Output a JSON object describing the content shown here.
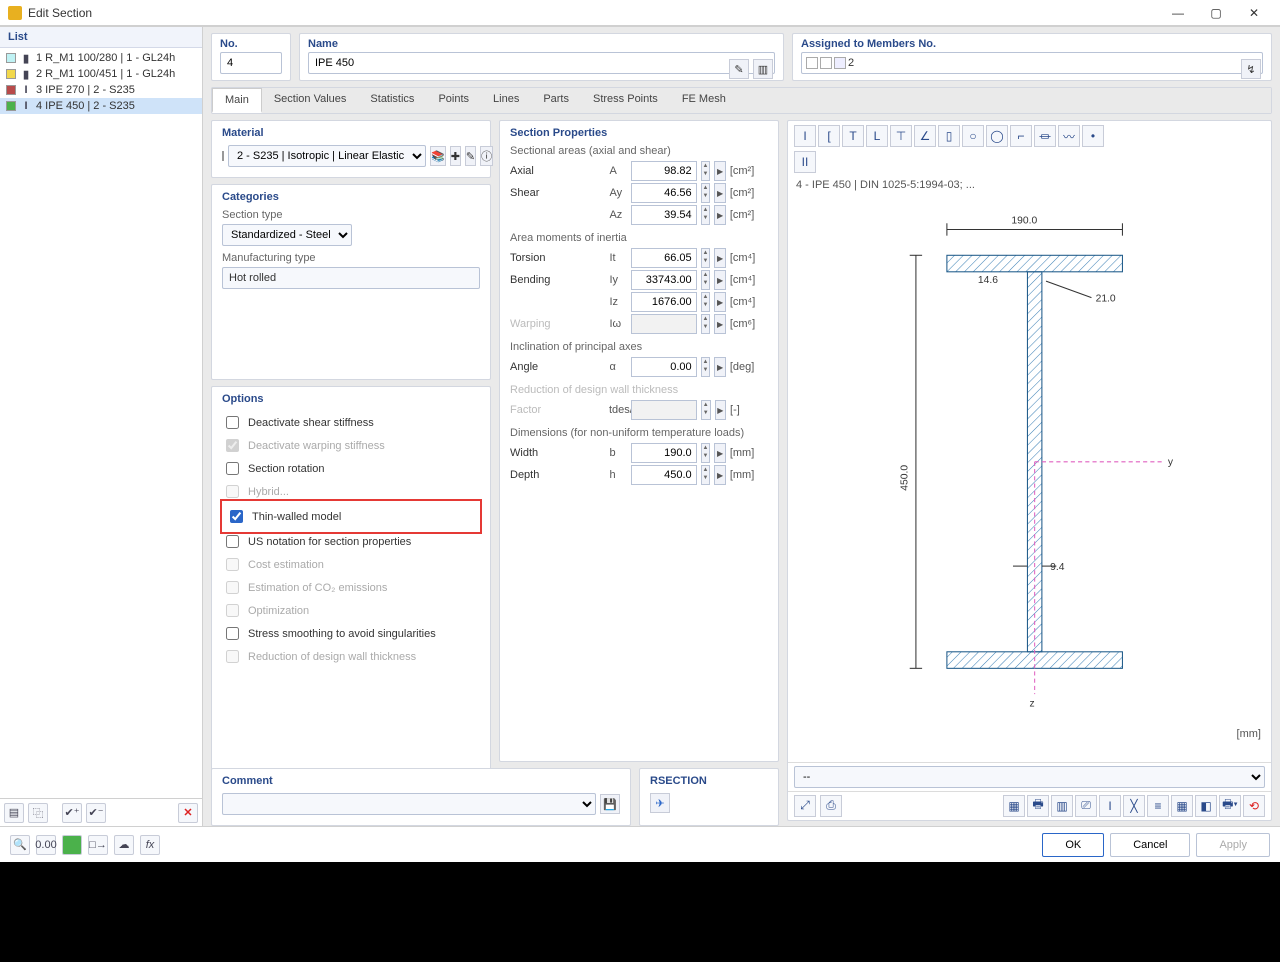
{
  "window": {
    "title": "Edit Section"
  },
  "left": {
    "header": "List",
    "items": [
      {
        "num": "1",
        "name": "R_M1 100/280 | 1 - GL24h",
        "sw": "#bff2f4",
        "sic": "▮",
        "selected": false
      },
      {
        "num": "2",
        "name": "R_M1 100/451 | 1 - GL24h",
        "sw": "#f2d84b",
        "sic": "▮",
        "selected": false
      },
      {
        "num": "3",
        "name": "IPE 270 | 2 - S235",
        "sw": "#b84b4b",
        "sic": "I",
        "selected": false
      },
      {
        "num": "4",
        "name": "IPE 450 | 2 - S235",
        "sw": "#4bb14b",
        "sic": "I",
        "selected": true
      }
    ]
  },
  "top": {
    "no_label": "No.",
    "no_value": "4",
    "name_label": "Name",
    "name_value": "IPE 450",
    "assigned_label": "Assigned to Members No.",
    "assigned_text": "2"
  },
  "tabs": {
    "items": [
      "Main",
      "Section Values",
      "Statistics",
      "Points",
      "Lines",
      "Parts",
      "Stress Points",
      "FE Mesh"
    ],
    "active": 0
  },
  "material": {
    "title": "Material",
    "value": "2 - S235 | Isotropic | Linear Elastic",
    "sw": "#8a6b4a"
  },
  "categories": {
    "title": "Categories",
    "type_label": "Section type",
    "type_value": "Standardized - Steel",
    "manuf_label": "Manufacturing type",
    "manuf_value": "Hot rolled"
  },
  "options": {
    "title": "Options",
    "items": [
      {
        "label": "Deactivate shear stiffness",
        "checked": false,
        "disabled": false
      },
      {
        "label": "Deactivate warping stiffness",
        "checked": true,
        "disabled": true
      },
      {
        "label": "Section rotation",
        "checked": false,
        "disabled": false
      },
      {
        "label": "Hybrid...",
        "checked": false,
        "disabled": true
      },
      {
        "label": "Thin-walled model",
        "checked": true,
        "disabled": false,
        "highlight": true
      },
      {
        "label": "US notation for section properties",
        "checked": false,
        "disabled": false
      },
      {
        "label": "Cost estimation",
        "checked": false,
        "disabled": true
      },
      {
        "label": "Estimation of CO₂ emissions",
        "checked": false,
        "disabled": true
      },
      {
        "label": "Optimization",
        "checked": false,
        "disabled": true
      },
      {
        "label": "Stress smoothing to avoid singularities",
        "checked": false,
        "disabled": false
      },
      {
        "label": "Reduction of design wall thickness",
        "checked": false,
        "disabled": true
      }
    ]
  },
  "props": {
    "title": "Section Properties",
    "groups": [
      {
        "head": "Sectional areas (axial and shear)",
        "rows": [
          {
            "label": "Axial",
            "sym": "A",
            "val": "98.82",
            "unit": "[cm²]"
          },
          {
            "label": "Shear",
            "sym": "Ay",
            "val": "46.56",
            "unit": "[cm²]"
          },
          {
            "label": "",
            "sym": "Az",
            "val": "39.54",
            "unit": "[cm²]"
          }
        ]
      },
      {
        "head": "Area moments of inertia",
        "rows": [
          {
            "label": "Torsion",
            "sym": "It",
            "val": "66.05",
            "unit": "[cm⁴]"
          },
          {
            "label": "Bending",
            "sym": "Iy",
            "val": "33743.00",
            "unit": "[cm⁴]"
          },
          {
            "label": "",
            "sym": "Iz",
            "val": "1676.00",
            "unit": "[cm⁴]"
          },
          {
            "label": "Warping",
            "sym": "Iω",
            "val": "",
            "unit": "[cm⁶]",
            "disabled": true
          }
        ]
      },
      {
        "head": "Inclination of principal axes",
        "rows": [
          {
            "label": "Angle",
            "sym": "α",
            "val": "0.00",
            "unit": "[deg]"
          }
        ]
      },
      {
        "head": "Reduction of design wall thickness",
        "disabled": true,
        "rows": [
          {
            "label": "Factor",
            "sym": "tdes/t",
            "val": "",
            "unit": "[-]",
            "disabled": true
          }
        ]
      },
      {
        "head": "Dimensions (for non-uniform temperature loads)",
        "rows": [
          {
            "label": "Width",
            "sym": "b",
            "val": "190.0",
            "unit": "[mm]"
          },
          {
            "label": "Depth",
            "sym": "h",
            "val": "450.0",
            "unit": "[mm]"
          }
        ]
      }
    ]
  },
  "preview": {
    "title": "4 - IPE 450 | DIN 1025-5:1994-03; ...",
    "dims": {
      "width": "190.0",
      "height": "450.0",
      "tf": "14.6",
      "tw": "9.4",
      "r": "21.0"
    },
    "unit": "[mm]"
  },
  "comment": {
    "title": "Comment"
  },
  "rsection": {
    "title": "RSECTION"
  },
  "footer": {
    "ok": "OK",
    "cancel": "Cancel",
    "apply": "Apply"
  }
}
